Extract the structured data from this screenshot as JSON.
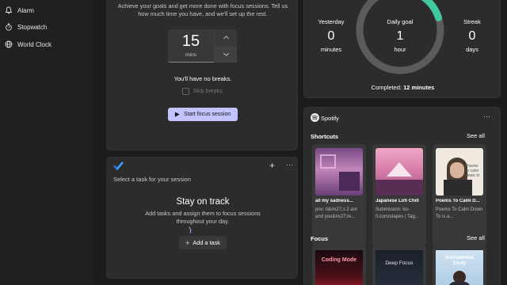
{
  "sidebar": {
    "items": [
      {
        "label": "Alarm",
        "icon": "bell-icon"
      },
      {
        "label": "Stopwatch",
        "icon": "stopwatch-icon"
      },
      {
        "label": "World Clock",
        "icon": "globe-icon"
      }
    ]
  },
  "focus": {
    "intro": "Achieve your goals and get more done with focus sessions. Tell us how much time you have, and we'll set up the rest.",
    "minutes_value": "15",
    "minutes_unit": "mins",
    "breaks_text": "You'll have no breaks.",
    "skip_breaks_label": "Skip breaks",
    "start_label": "Start focus session"
  },
  "tasks": {
    "select_prompt": "Select a task for your session",
    "heading": "Stay on track",
    "body": "Add tasks and assign them to focus sessions throughout your day.",
    "add_label": "Add a task"
  },
  "progress": {
    "yesterday_label": "Yesterday",
    "yesterday_value": "0",
    "yesterday_unit": "minutes",
    "goal_label": "Daily goal",
    "goal_value": "1",
    "goal_unit": "hour",
    "goal_fraction": 0.2,
    "streak_label": "Streak",
    "streak_value": "0",
    "streak_unit": "days",
    "completed_label": "Completed:",
    "completed_value": "12 minutes",
    "accent": "#40c8a0"
  },
  "spotify": {
    "title": "Spotify",
    "shortcuts_label": "Shortcuts",
    "focus_label": "Focus",
    "see_all": "See all",
    "shortcuts": [
      {
        "title": "all my sadness...",
        "subtitle": "pov: it&#x27;s 2 am and you&#x27;re..."
      },
      {
        "title": "Japanese Lofi Chill",
        "subtitle": "Submission: ko-fi.com/stapes | Tag..."
      },
      {
        "title": "Poems To Calm D...",
        "subtitle": "Poems To Calm Down To is a..."
      }
    ],
    "focus_items": [
      {
        "title": "Coding Mode"
      },
      {
        "title": "Deep Focus"
      },
      {
        "title": "Instrumental Study"
      }
    ],
    "art_caption": "Poems to calm down to"
  }
}
